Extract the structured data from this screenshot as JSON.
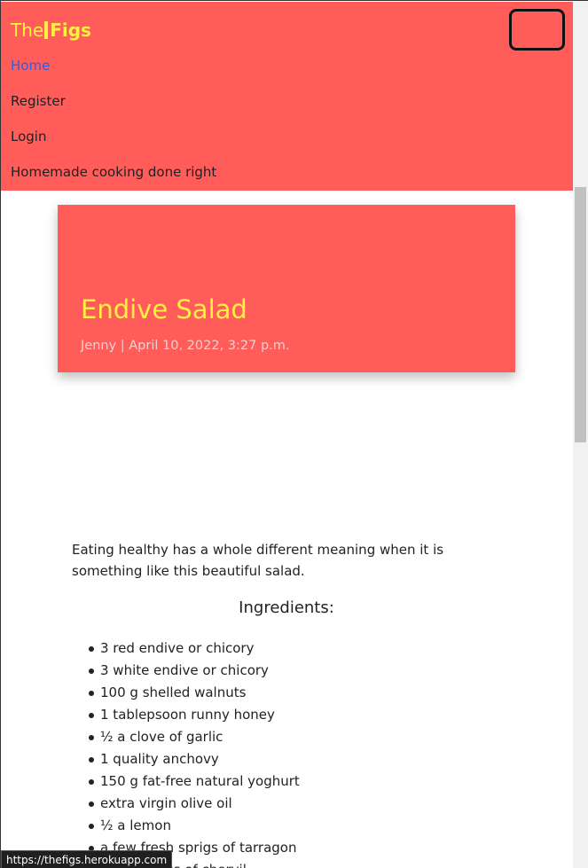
{
  "navbar": {
    "brand_the": "The",
    "brand_figs": "Figs",
    "links": [
      {
        "label": "Home",
        "active": true
      },
      {
        "label": "Register",
        "active": false
      },
      {
        "label": "Login",
        "active": false
      },
      {
        "label": "Homemade cooking done right",
        "active": false
      }
    ]
  },
  "post": {
    "title": "Endive Salad",
    "meta": "Jenny | April 10, 2022, 3:27 p.m.",
    "intro": "Eating healthy has a whole different meaning when it is something like this beautiful salad.",
    "ingredients_heading": "Ingredients:",
    "ingredients": [
      "3 red endive or chicory",
      "3 white endive or chicory",
      "100 g shelled walnuts",
      "1 tablepsoon runny honey",
      "½ a clove of garlic",
      "1 quality anchovy",
      "150 g fat-free natural yoghurt",
      "extra virgin olive oil",
      "½ a lemon",
      "a few fresh sprigs of tarragon",
      "a few sprigs of chervil"
    ]
  },
  "status_bar": {
    "url": "https://thefigs.herokuapp.com"
  },
  "colors": {
    "brand_red": "#ff5c5a",
    "brand_yellow": "#ffee44",
    "active_link": "#3b5bd6"
  }
}
